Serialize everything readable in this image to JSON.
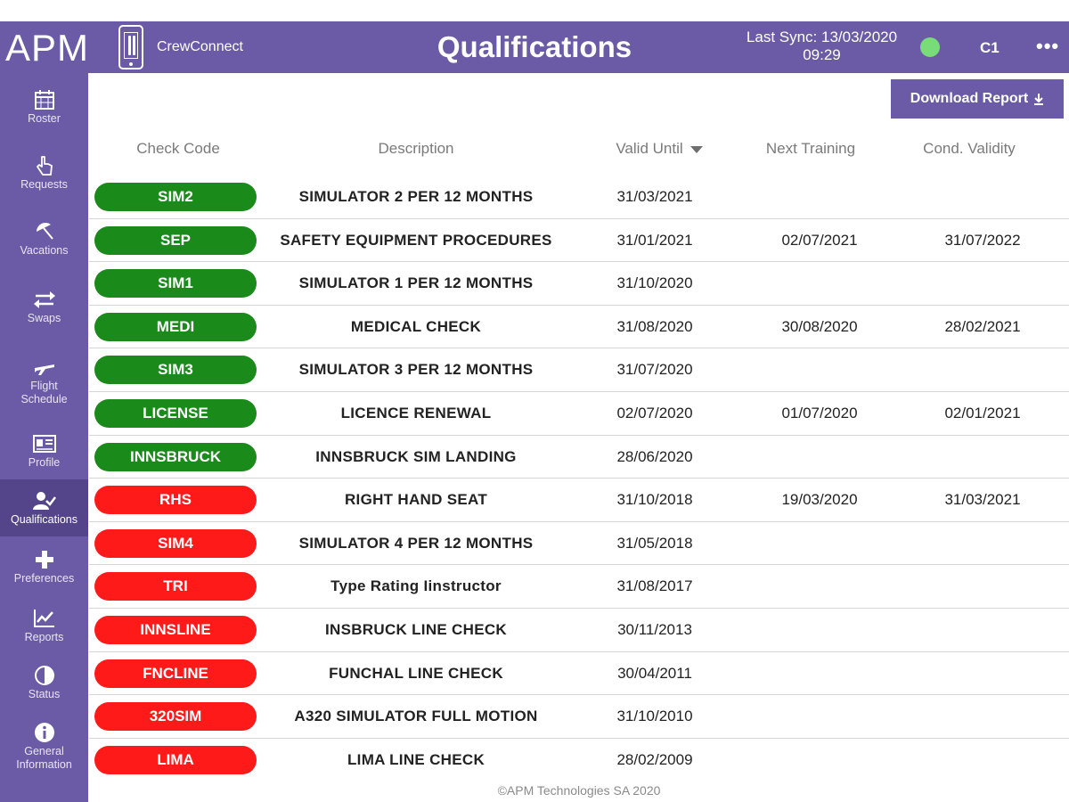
{
  "colors": {
    "brand": "#6b5ba6",
    "valid": "#1a8a1a",
    "expired": "#ff1a1a",
    "sync_ok": "#78dc78"
  },
  "header": {
    "logo": "APM",
    "app_name": "CrewConnect",
    "title": "Qualifications",
    "sync_line1": "Last Sync: 13/03/2020",
    "sync_line2": "09:29",
    "user_code": "C1",
    "more": "•••"
  },
  "sidebar": {
    "items": [
      {
        "label": "Roster",
        "icon": "calendar-icon"
      },
      {
        "label": "Requests",
        "icon": "hand-pointer-icon"
      },
      {
        "label": "Vacations",
        "icon": "beach-umbrella-icon"
      },
      {
        "label": "Swaps",
        "icon": "swap-arrows-icon"
      },
      {
        "label": "Flight Schedule",
        "icon": "plane-icon"
      },
      {
        "label": "Profile",
        "icon": "id-card-icon"
      },
      {
        "label": "Qualifications",
        "icon": "user-check-icon",
        "active": true
      },
      {
        "label": "Preferences",
        "icon": "plus-icon"
      },
      {
        "label": "Reports",
        "icon": "chart-icon"
      },
      {
        "label": "Status",
        "icon": "half-circle-icon"
      },
      {
        "label": "General Information",
        "icon": "info-icon"
      }
    ]
  },
  "toolbar": {
    "download_label": "Download Report",
    "download_icon": "download-icon"
  },
  "table": {
    "columns": [
      "Check Code",
      "Description",
      "Valid Until",
      "Next Training",
      "Cond. Validity"
    ],
    "sorted_column": "Valid Until",
    "rows": [
      {
        "code": "SIM2",
        "status": "valid",
        "description": "SIMULATOR 2 PER 12 MONTHS",
        "valid_until": "31/03/2021",
        "next_training": "",
        "cond_validity": ""
      },
      {
        "code": "SEP",
        "status": "valid",
        "description": "SAFETY EQUIPMENT PROCEDURES",
        "valid_until": "31/01/2021",
        "next_training": "02/07/2021",
        "cond_validity": "31/07/2022"
      },
      {
        "code": "SIM1",
        "status": "valid",
        "description": "SIMULATOR 1 PER 12 MONTHS",
        "valid_until": "31/10/2020",
        "next_training": "",
        "cond_validity": ""
      },
      {
        "code": "MEDI",
        "status": "valid",
        "description": "MEDICAL CHECK",
        "valid_until": "31/08/2020",
        "next_training": "30/08/2020",
        "cond_validity": "28/02/2021"
      },
      {
        "code": "SIM3",
        "status": "valid",
        "description": "SIMULATOR 3 PER 12 MONTHS",
        "valid_until": "31/07/2020",
        "next_training": "",
        "cond_validity": ""
      },
      {
        "code": "LICENSE",
        "status": "valid",
        "description": "LICENCE RENEWAL",
        "valid_until": "02/07/2020",
        "next_training": "01/07/2020",
        "cond_validity": "02/01/2021"
      },
      {
        "code": "INNSBRUCK",
        "status": "valid",
        "description": "INNSBRUCK SIM LANDING",
        "valid_until": "28/06/2020",
        "next_training": "",
        "cond_validity": ""
      },
      {
        "code": "RHS",
        "status": "expired",
        "description": "RIGHT HAND SEAT",
        "valid_until": "31/10/2018",
        "next_training": "19/03/2020",
        "cond_validity": "31/03/2021"
      },
      {
        "code": "SIM4",
        "status": "expired",
        "description": "SIMULATOR 4 PER 12 MONTHS",
        "valid_until": "31/05/2018",
        "next_training": "",
        "cond_validity": ""
      },
      {
        "code": "TRI",
        "status": "expired",
        "description": "Type Rating Iinstructor",
        "valid_until": "31/08/2017",
        "next_training": "",
        "cond_validity": ""
      },
      {
        "code": "INNSLINE",
        "status": "expired",
        "description": "INSBRUCK LINE CHECK",
        "valid_until": "30/11/2013",
        "next_training": "",
        "cond_validity": ""
      },
      {
        "code": "FNCLINE",
        "status": "expired",
        "description": "FUNCHAL LINE CHECK",
        "valid_until": "30/04/2011",
        "next_training": "",
        "cond_validity": ""
      },
      {
        "code": "320SIM",
        "status": "expired",
        "description": "A320 SIMULATOR FULL MOTION",
        "valid_until": "31/10/2010",
        "next_training": "",
        "cond_validity": ""
      },
      {
        "code": "LIMA",
        "status": "expired",
        "description": "LIMA LINE CHECK",
        "valid_until": "28/02/2009",
        "next_training": "",
        "cond_validity": ""
      }
    ]
  },
  "footer": {
    "copyright": "©APM Technologies SA 2020"
  }
}
